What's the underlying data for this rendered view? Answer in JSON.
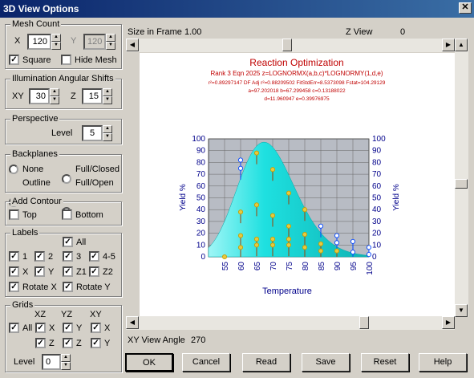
{
  "window": {
    "title": "3D View Options",
    "close": "✕"
  },
  "mesh": {
    "title": "Mesh Count",
    "x_label": "X",
    "x_value": "120",
    "y_label": "Y",
    "y_value": "120",
    "square": "Square",
    "hide_mesh": "Hide Mesh"
  },
  "illum": {
    "title": "Illumination Angular Shifts",
    "xy_label": "XY",
    "xy_value": "30",
    "z_label": "Z",
    "z_value": "15"
  },
  "persp": {
    "title": "Perspective",
    "level_label": "Level",
    "level_value": "5"
  },
  "backplanes": {
    "title": "Backplanes",
    "none": "None",
    "full_closed": "Full/Closed",
    "outline": "Outline",
    "full_open": "Full/Open"
  },
  "contour": {
    "title": "Add Contour",
    "top": "Top",
    "bottom": "Bottom"
  },
  "labels": {
    "title": "Labels",
    "all": "All",
    "c1": "1",
    "c2": "2",
    "c3": "3",
    "c45": "4-5",
    "x": "X",
    "y": "Y",
    "z1": "Z1",
    "z2": "Z2",
    "rotx": "Rotate X",
    "roty": "Rotate Y"
  },
  "grids": {
    "title": "Grids",
    "h_xz": "XZ",
    "h_yz": "YZ",
    "h_xy": "XY",
    "all": "All",
    "x1": "X",
    "y1": "Y",
    "x2": "X",
    "z1": "Z",
    "z2": "Z",
    "y2": "Y",
    "level_label": "Level",
    "level_value": "0"
  },
  "top": {
    "size_label": "Size in Frame",
    "size_value": "1.00",
    "zview_label": "Z View",
    "zview_value": "0"
  },
  "bottom": {
    "xyview_label": "XY View Angle",
    "xyview_value": "270"
  },
  "buttons": {
    "ok": "OK",
    "cancel": "Cancel",
    "read": "Read",
    "save": "Save",
    "reset": "Reset",
    "help": "Help"
  },
  "chart_data": {
    "type": "surface3d",
    "title": "Reaction Optimization",
    "subtitle1": "Rank 3  Eqn 2025  z=LOGNORMX(a,b,c)*LOGNORMY(1,d,e)",
    "subtitle2": "r²=0.89297147  DF Adj r²=0.88209502  FitStdErr=8.5373098  Fstat=104.29129",
    "subtitle3": "a=97.202018 b=67.299458 c=0.13188022",
    "subtitle4": "d=11.960947 e=0.39976975",
    "xlabel": "Temperature",
    "ylabel_left": "Yield %",
    "ylabel_right": "Yield %",
    "x_ticks": [
      "55",
      "60",
      "65",
      "70",
      "75",
      "80",
      "85",
      "90",
      "95",
      "100"
    ],
    "y_ticks": [
      "0",
      "10",
      "20",
      "30",
      "40",
      "50",
      "60",
      "70",
      "80",
      "90",
      "100"
    ],
    "ylim": [
      0,
      100
    ],
    "xlim": [
      50,
      100
    ],
    "surface": {
      "peak_x": 67.3,
      "peak_y": 97.2,
      "color": "#1ee0e0"
    },
    "points": [
      {
        "x": 55,
        "y": 0
      },
      {
        "x": 60,
        "y": 82
      },
      {
        "x": 60,
        "y": 75
      },
      {
        "x": 60,
        "y": 38
      },
      {
        "x": 60,
        "y": 18
      },
      {
        "x": 60,
        "y": 8
      },
      {
        "x": 65,
        "y": 88
      },
      {
        "x": 65,
        "y": 44
      },
      {
        "x": 65,
        "y": 15
      },
      {
        "x": 65,
        "y": 10
      },
      {
        "x": 70,
        "y": 74
      },
      {
        "x": 70,
        "y": 35
      },
      {
        "x": 70,
        "y": 15
      },
      {
        "x": 70,
        "y": 10
      },
      {
        "x": 75,
        "y": 54
      },
      {
        "x": 75,
        "y": 26
      },
      {
        "x": 75,
        "y": 15
      },
      {
        "x": 75,
        "y": 10
      },
      {
        "x": 80,
        "y": 40
      },
      {
        "x": 80,
        "y": 19
      },
      {
        "x": 80,
        "y": 8
      },
      {
        "x": 85,
        "y": 26
      },
      {
        "x": 85,
        "y": 11
      },
      {
        "x": 85,
        "y": 5
      },
      {
        "x": 90,
        "y": 18
      },
      {
        "x": 90,
        "y": 12
      },
      {
        "x": 90,
        "y": 5
      },
      {
        "x": 95,
        "y": 13
      },
      {
        "x": 95,
        "y": 4
      },
      {
        "x": 100,
        "y": 8
      },
      {
        "x": 100,
        "y": 2
      }
    ]
  }
}
